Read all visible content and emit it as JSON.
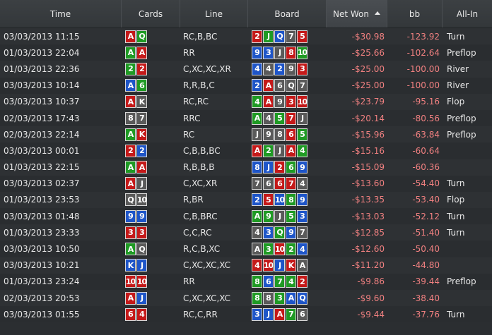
{
  "columns": [
    {
      "key": "time",
      "label": "Time",
      "width": 172
    },
    {
      "key": "cards",
      "label": "Cards",
      "width": 83
    },
    {
      "key": "line",
      "label": "Line",
      "width": 96
    },
    {
      "key": "board",
      "label": "Board",
      "width": 111
    },
    {
      "key": "net",
      "label": "Net Won",
      "width": 86,
      "sorted": true
    },
    {
      "key": "bb",
      "label": "bb",
      "width": 78
    },
    {
      "key": "allin",
      "label": "All-In",
      "width": 70
    }
  ],
  "colors": {
    "h": "#c41919",
    "d": "#1e55c8",
    "c": "#1f9a24",
    "s": "#5a5a5a",
    "negative": "#f08080"
  },
  "rows": [
    {
      "time": "03/03/2013 11:15",
      "cards": [
        [
          "A",
          "h"
        ],
        [
          "Q",
          "c"
        ]
      ],
      "line": "RC,B,BC",
      "board": [
        [
          "2",
          "h"
        ],
        [
          "J",
          "c"
        ],
        [
          "Q",
          "d"
        ],
        [
          "7",
          "s"
        ],
        [
          "5",
          "h"
        ]
      ],
      "net": "-$30.98",
      "bb": "-123.92",
      "allin": "Turn"
    },
    {
      "time": "01/03/2013 22:04",
      "cards": [
        [
          "A",
          "c"
        ],
        [
          "A",
          "h"
        ]
      ],
      "line": "RR",
      "board": [
        [
          "9",
          "d"
        ],
        [
          "3",
          "d"
        ],
        [
          "J",
          "s"
        ],
        [
          "8",
          "h"
        ],
        [
          "10",
          "c"
        ]
      ],
      "net": "-$25.66",
      "bb": "-102.64",
      "allin": "Preflop"
    },
    {
      "time": "01/03/2013 22:36",
      "cards": [
        [
          "2",
          "c"
        ],
        [
          "2",
          "h"
        ]
      ],
      "line": "C,XC,XC,XR",
      "board": [
        [
          "4",
          "d"
        ],
        [
          "4",
          "s"
        ],
        [
          "2",
          "d"
        ],
        [
          "9",
          "s"
        ],
        [
          "3",
          "h"
        ]
      ],
      "net": "-$25.00",
      "bb": "-100.00",
      "allin": "River"
    },
    {
      "time": "03/03/2013 10:14",
      "cards": [
        [
          "A",
          "d"
        ],
        [
          "6",
          "c"
        ]
      ],
      "line": "R,R,B,C",
      "board": [
        [
          "2",
          "d"
        ],
        [
          "A",
          "h"
        ],
        [
          "6",
          "s"
        ],
        [
          "Q",
          "s"
        ],
        [
          "7",
          "s"
        ]
      ],
      "net": "-$25.00",
      "bb": "-100.00",
      "allin": "River"
    },
    {
      "time": "03/03/2013 10:37",
      "cards": [
        [
          "A",
          "h"
        ],
        [
          "K",
          "s"
        ]
      ],
      "line": "RC,RC",
      "board": [
        [
          "4",
          "c"
        ],
        [
          "A",
          "h"
        ],
        [
          "9",
          "s"
        ],
        [
          "3",
          "h"
        ],
        [
          "10",
          "h"
        ]
      ],
      "net": "-$23.79",
      "bb": "-95.16",
      "allin": "Flop"
    },
    {
      "time": "02/03/2013 17:43",
      "cards": [
        [
          "8",
          "s"
        ],
        [
          "7",
          "s"
        ]
      ],
      "line": "RRC",
      "board": [
        [
          "A",
          "c"
        ],
        [
          "4",
          "s"
        ],
        [
          "5",
          "c"
        ],
        [
          "7",
          "h"
        ],
        [
          "J",
          "s"
        ]
      ],
      "net": "-$20.14",
      "bb": "-80.56",
      "allin": "Preflop"
    },
    {
      "time": "02/03/2013 22:14",
      "cards": [
        [
          "A",
          "c"
        ],
        [
          "K",
          "h"
        ]
      ],
      "line": "RC",
      "board": [
        [
          "J",
          "s"
        ],
        [
          "9",
          "s"
        ],
        [
          "8",
          "s"
        ],
        [
          "6",
          "h"
        ],
        [
          "5",
          "c"
        ]
      ],
      "net": "-$15.96",
      "bb": "-63.84",
      "allin": "Preflop"
    },
    {
      "time": "03/03/2013 00:01",
      "cards": [
        [
          "2",
          "h"
        ],
        [
          "2",
          "d"
        ]
      ],
      "line": "C,B,B,BC",
      "board": [
        [
          "A",
          "h"
        ],
        [
          "2",
          "c"
        ],
        [
          "J",
          "s"
        ],
        [
          "A",
          "h"
        ],
        [
          "4",
          "c"
        ]
      ],
      "net": "-$15.16",
      "bb": "-60.64",
      "allin": ""
    },
    {
      "time": "01/03/2013 22:15",
      "cards": [
        [
          "A",
          "c"
        ],
        [
          "A",
          "h"
        ]
      ],
      "line": "R,B,B,B",
      "board": [
        [
          "8",
          "d"
        ],
        [
          "J",
          "d"
        ],
        [
          "2",
          "h"
        ],
        [
          "6",
          "c"
        ],
        [
          "9",
          "d"
        ]
      ],
      "net": "-$15.09",
      "bb": "-60.36",
      "allin": ""
    },
    {
      "time": "03/03/2013 02:37",
      "cards": [
        [
          "A",
          "h"
        ],
        [
          "J",
          "s"
        ]
      ],
      "line": "C,XC,XR",
      "board": [
        [
          "7",
          "s"
        ],
        [
          "6",
          "s"
        ],
        [
          "6",
          "h"
        ],
        [
          "7",
          "h"
        ],
        [
          "4",
          "s"
        ]
      ],
      "net": "-$13.60",
      "bb": "-54.40",
      "allin": "Turn"
    },
    {
      "time": "01/03/2013 23:53",
      "cards": [
        [
          "Q",
          "s"
        ],
        [
          "10",
          "s"
        ]
      ],
      "line": "R,BR",
      "board": [
        [
          "2",
          "d"
        ],
        [
          "5",
          "h"
        ],
        [
          "10",
          "d"
        ],
        [
          "8",
          "c"
        ],
        [
          "9",
          "d"
        ]
      ],
      "net": "-$13.35",
      "bb": "-53.40",
      "allin": "Flop"
    },
    {
      "time": "03/03/2013 01:48",
      "cards": [
        [
          "9",
          "d"
        ],
        [
          "9",
          "d"
        ]
      ],
      "line": "C,B,BRC",
      "board": [
        [
          "A",
          "c"
        ],
        [
          "9",
          "c"
        ],
        [
          "J",
          "s"
        ],
        [
          "5",
          "c"
        ],
        [
          "3",
          "d"
        ]
      ],
      "net": "-$13.03",
      "bb": "-52.12",
      "allin": "Turn"
    },
    {
      "time": "01/03/2013 23:33",
      "cards": [
        [
          "3",
          "h"
        ],
        [
          "3",
          "h"
        ]
      ],
      "line": "C,C,RC",
      "board": [
        [
          "4",
          "s"
        ],
        [
          "3",
          "d"
        ],
        [
          "Q",
          "c"
        ],
        [
          "9",
          "d"
        ],
        [
          "7",
          "s"
        ]
      ],
      "net": "-$12.85",
      "bb": "-51.40",
      "allin": "Turn"
    },
    {
      "time": "03/03/2013 10:50",
      "cards": [
        [
          "A",
          "c"
        ],
        [
          "Q",
          "s"
        ]
      ],
      "line": "R,C,B,XC",
      "board": [
        [
          "A",
          "s"
        ],
        [
          "3",
          "c"
        ],
        [
          "10",
          "h"
        ],
        [
          "2",
          "c"
        ],
        [
          "4",
          "d"
        ]
      ],
      "net": "-$12.60",
      "bb": "-50.40",
      "allin": ""
    },
    {
      "time": "03/03/2013 10:21",
      "cards": [
        [
          "K",
          "d"
        ],
        [
          "J",
          "d"
        ]
      ],
      "line": "C,XC,XC,XC",
      "board": [
        [
          "4",
          "h"
        ],
        [
          "10",
          "h"
        ],
        [
          "J",
          "d"
        ],
        [
          "K",
          "h"
        ],
        [
          "A",
          "s"
        ]
      ],
      "net": "-$11.20",
      "bb": "-44.80",
      "allin": ""
    },
    {
      "time": "01/03/2013 23:24",
      "cards": [
        [
          "10",
          "h"
        ],
        [
          "10",
          "h"
        ]
      ],
      "line": "RR",
      "board": [
        [
          "8",
          "c"
        ],
        [
          "6",
          "d"
        ],
        [
          "7",
          "c"
        ],
        [
          "4",
          "c"
        ],
        [
          "2",
          "h"
        ]
      ],
      "net": "-$9.86",
      "bb": "-39.44",
      "allin": "Preflop"
    },
    {
      "time": "02/03/2013 20:53",
      "cards": [
        [
          "A",
          "h"
        ],
        [
          "J",
          "d"
        ]
      ],
      "line": "C,XC,XC,XC",
      "board": [
        [
          "8",
          "c"
        ],
        [
          "8",
          "s"
        ],
        [
          "3",
          "c"
        ],
        [
          "A",
          "d"
        ],
        [
          "Q",
          "d"
        ]
      ],
      "net": "-$9.60",
      "bb": "-38.40",
      "allin": ""
    },
    {
      "time": "03/03/2013 01:55",
      "cards": [
        [
          "6",
          "h"
        ],
        [
          "4",
          "h"
        ]
      ],
      "line": "RC,C,RR",
      "board": [
        [
          "3",
          "d"
        ],
        [
          "J",
          "d"
        ],
        [
          "A",
          "h"
        ],
        [
          "7",
          "c"
        ],
        [
          "6",
          "s"
        ]
      ],
      "net": "-$9.44",
      "bb": "-37.76",
      "allin": "Turn"
    }
  ]
}
